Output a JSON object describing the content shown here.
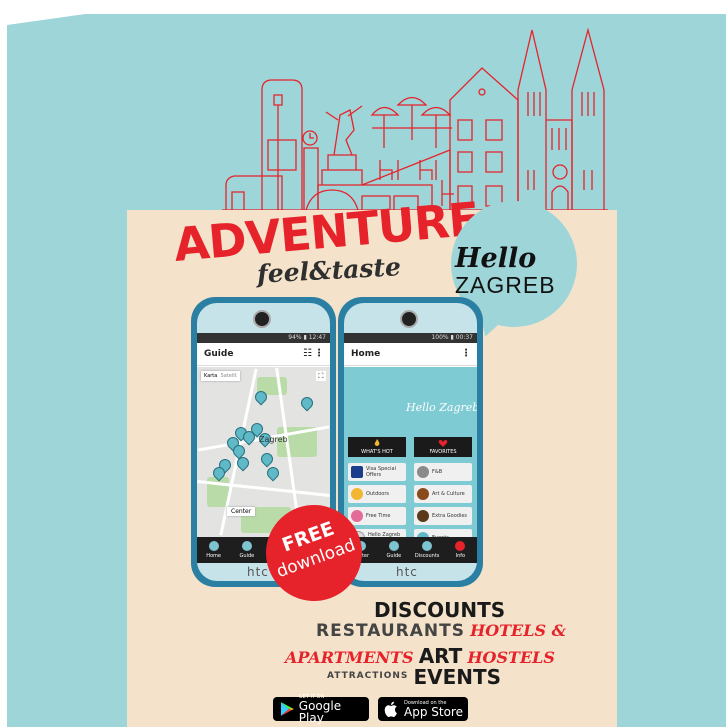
{
  "poster": {
    "headline": "ADVENTURE",
    "tagline": "feel&taste",
    "brand_script": "Hello",
    "brand_city": "ZAGREB",
    "free_badge": {
      "line1": "FREE",
      "line2": "download"
    },
    "categories": {
      "discounts": "DISCOUNTS",
      "restaurants": "RESTAURANTS",
      "hotels": "HOTELS &",
      "apartments": "APARTMENTS",
      "art": "ART",
      "hostels": "HOSTELS",
      "attractions": "ATTRACTIONS",
      "events": "EVENTS"
    },
    "stores": {
      "google_small": "GET IT ON",
      "google_big": "Google Play",
      "apple_small": "Download on the",
      "apple_big": "App Store"
    }
  },
  "phone_left": {
    "status": "94% ▮ 12:47",
    "title": "Guide",
    "map_tabs": [
      "Karta",
      "Satelit"
    ],
    "map_city_label": "Zagreb",
    "map_center": "Center",
    "brand": "htc",
    "nav": [
      "Home",
      "Guide"
    ]
  },
  "phone_right": {
    "status": "100% ▮ 00:37",
    "title": "Home",
    "script_title": "Hello Zagreb",
    "whats_hot": "WHAT'S HOT",
    "favorites": "FAVORITES",
    "menu": [
      {
        "label": "Visa Special Offers",
        "color": "#1a3e8c"
      },
      {
        "label": "F&B",
        "color": "#8a8a8a"
      },
      {
        "label": "Outdoors",
        "color": "#f2b632"
      },
      {
        "label": "Art & Culture",
        "color": "#8b4a1c"
      },
      {
        "label": "Free Time",
        "color": "#e46a9a"
      },
      {
        "label": "Extra Goodies",
        "color": "#5a3a1a"
      },
      {
        "label": "Hello Zagreb Merch",
        "color": "#dcdcdc"
      },
      {
        "label": "Events",
        "color": "#5fb9c6"
      }
    ],
    "nav": [
      "Center",
      "Guide",
      "Discounts",
      "Info"
    ],
    "brand": "htc"
  },
  "colors": {
    "accent_red": "#e6232a",
    "teal": "#9dd5d9",
    "cream": "#f4e3ca"
  }
}
